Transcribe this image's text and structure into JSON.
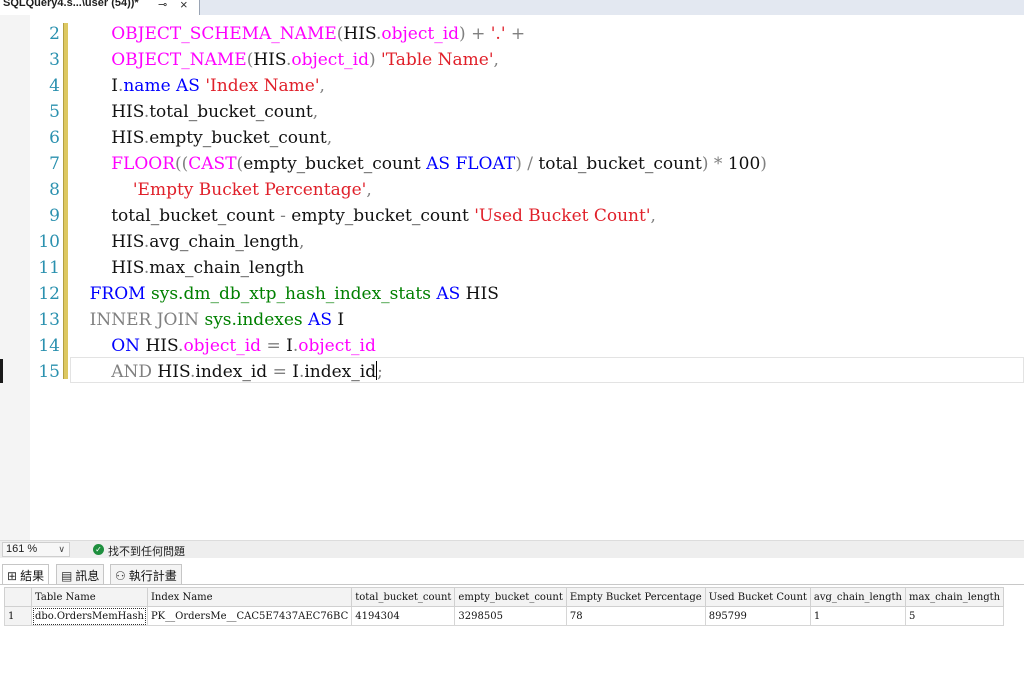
{
  "tab": {
    "title": "SQLQuery4.s...\\user (54))*",
    "pin_icon": "pin-icon",
    "close_icon": "close-icon"
  },
  "editor": {
    "line_numbers": [
      "2",
      "3",
      "4",
      "5",
      "6",
      "7",
      "8",
      "9",
      "10",
      "11",
      "12",
      "13",
      "14",
      "15"
    ]
  },
  "status": {
    "zoom": "161 %",
    "message": "找不到任何問題"
  },
  "result_tabs": [
    {
      "label": "結果",
      "icon": "grid-icon"
    },
    {
      "label": "訊息",
      "icon": "message-icon"
    },
    {
      "label": "執行計畫",
      "icon": "execution-plan-icon"
    }
  ],
  "grid": {
    "columns": [
      "Table Name",
      "Index Name",
      "total_bucket_count",
      "empty_bucket_count",
      "Empty Bucket Percentage",
      "Used Bucket Count",
      "avg_chain_length",
      "max_chain_length"
    ],
    "rows": [
      {
        "rownum": "1",
        "cells": [
          "dbo.OrdersMemHash",
          "PK__OrdersMe__CAC5E7437AEC76BC",
          "4194304",
          "3298505",
          "78",
          "895799",
          "1",
          "5"
        ]
      }
    ]
  }
}
